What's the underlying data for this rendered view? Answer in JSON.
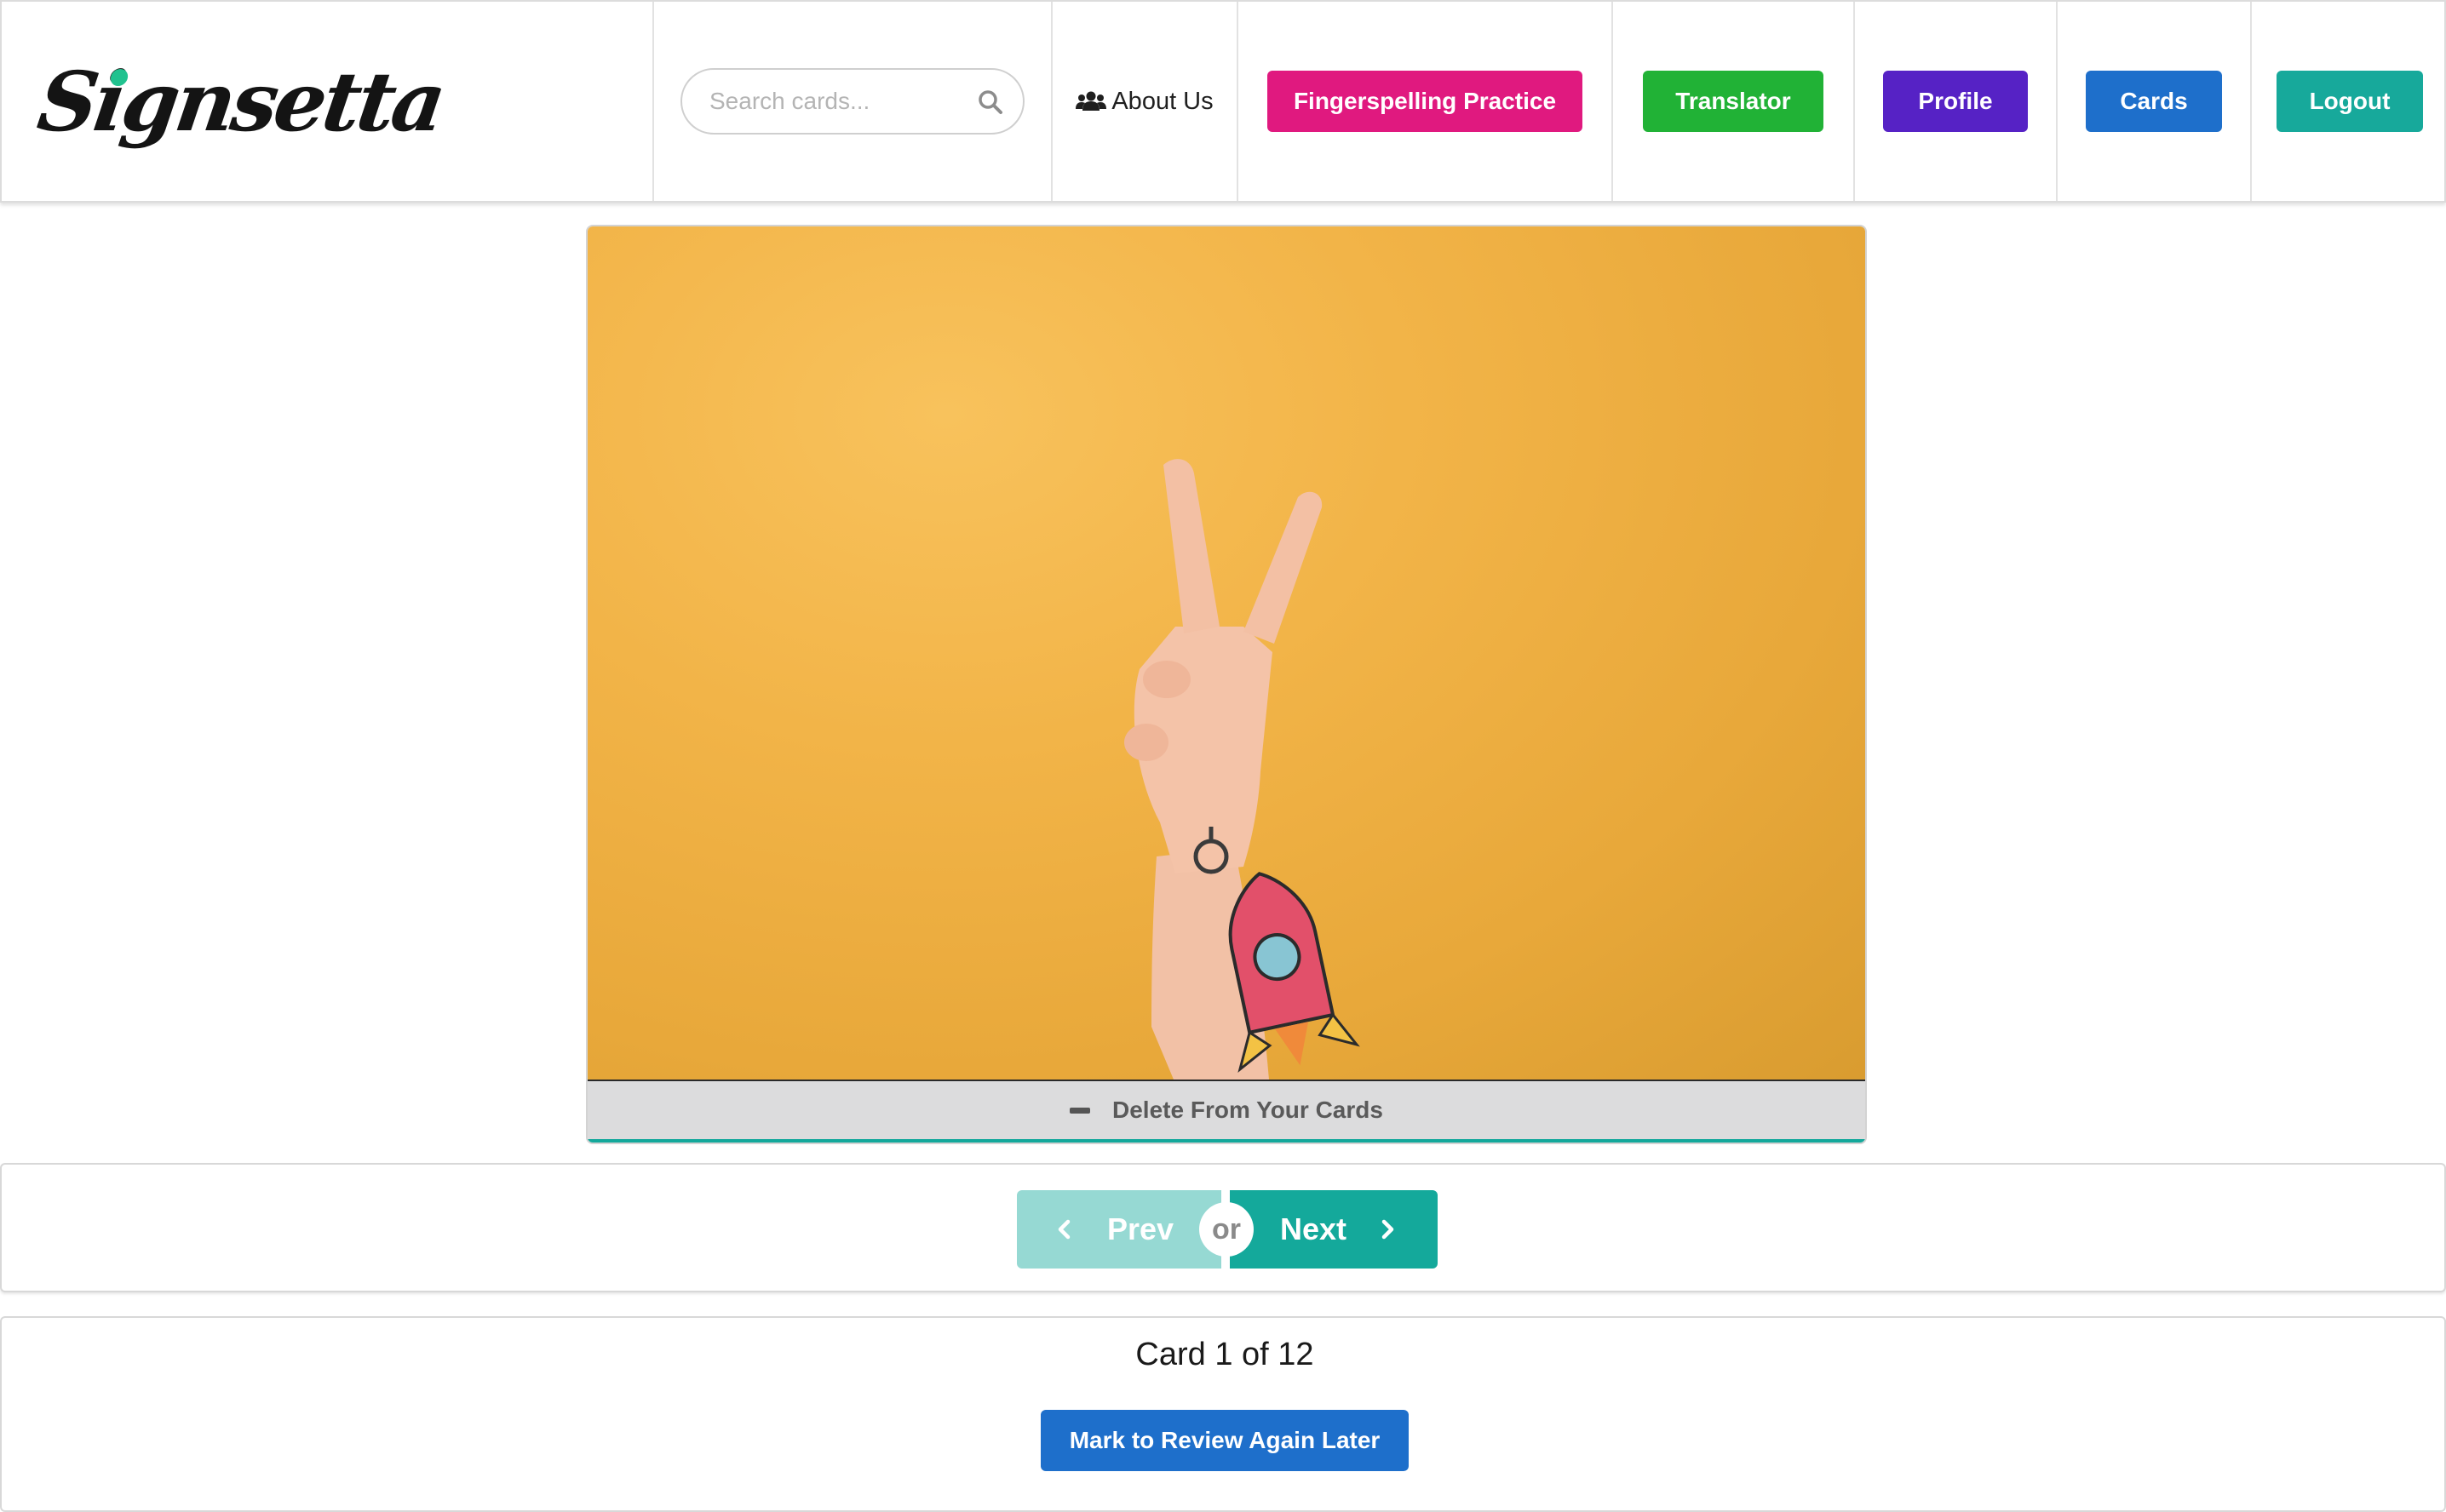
{
  "header": {
    "logo_text": "Signsetta",
    "search": {
      "placeholder": "Search cards...",
      "value": ""
    },
    "nav": {
      "about_label": "About Us",
      "fingerspelling_label": "Fingerspelling Practice",
      "translator_label": "Translator",
      "profile_label": "Profile",
      "cards_label": "Cards",
      "logout_label": "Logout"
    }
  },
  "card": {
    "delete_label": "Delete From Your Cards"
  },
  "pager": {
    "prev_label": "Prev",
    "or_label": "or",
    "next_label": "Next"
  },
  "status": {
    "counter_text": "Card 1 of 12",
    "review_label": "Mark to Review Again Later"
  },
  "colors": {
    "fingerspelling": "#e0197f",
    "translator": "#21b236",
    "profile": "#5622c5",
    "cards": "#1e6fcb",
    "logout": "#17a99b",
    "next": "#14a99b",
    "prev_disabled": "#96d9d3",
    "card_background": "#f2b448"
  },
  "icons": [
    "logo",
    "search-icon",
    "users-icon",
    "minus-icon",
    "chevron-left-icon",
    "chevron-right-icon"
  ]
}
